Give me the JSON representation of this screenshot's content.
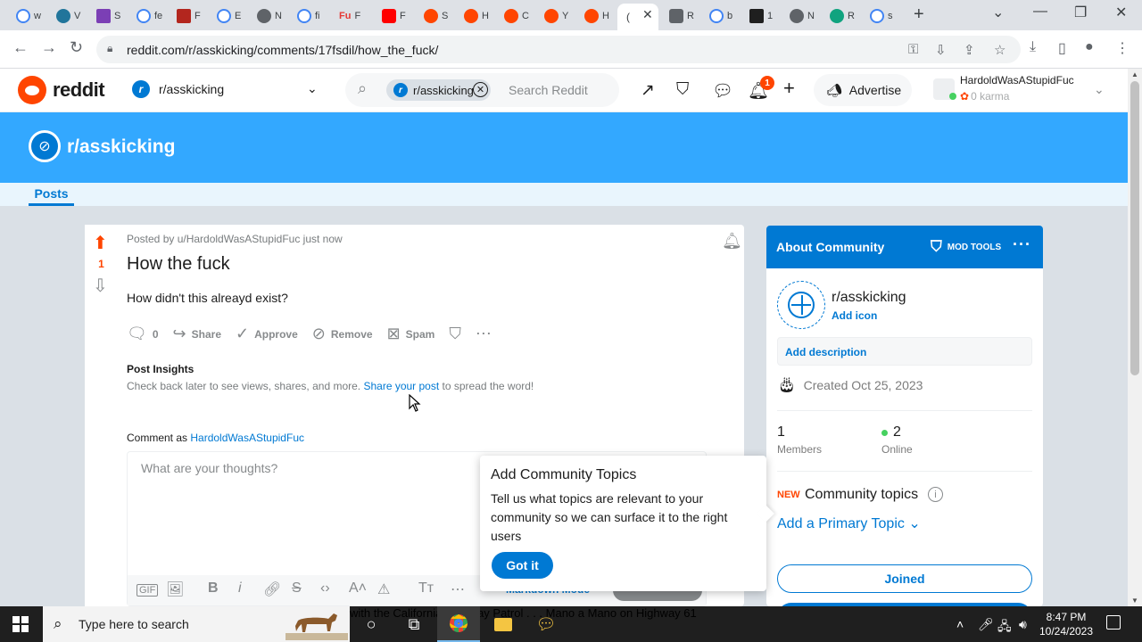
{
  "browser": {
    "tab_count": 22,
    "url": "reddit.com/r/asskicking/comments/17fsdil/how_the_fuck/"
  },
  "reddit_header": {
    "wordmark": "reddit",
    "community": "r/asskicking",
    "search_chip": "r/asskicking",
    "search_placeholder": "Search Reddit",
    "notification_count": "1",
    "advertise": "Advertise",
    "username": "HardoldWasAStupidFuc",
    "karma": "0 karma"
  },
  "banner": {
    "name": "r/asskicking",
    "nav_posts": "Posts"
  },
  "post": {
    "score": "1",
    "posted_by": "Posted by u/HardoldWasAStupidFuc just now",
    "title": "How the fuck",
    "body": "How didn't this alreayd exist?",
    "actions": {
      "comments": "0",
      "share": "Share",
      "approve": "Approve",
      "remove": "Remove",
      "spam": "Spam"
    },
    "insights_heading": "Post Insights",
    "insights_text_pre": "Check back later to see views, shares, and more.",
    "insights_link": "Share your post",
    "insights_text_post": "to spread the word!",
    "comment_as_label": "Comment as",
    "comment_as_user": "HardoldWasAStupidFuc",
    "comment_placeholder": "What are your thoughts?",
    "markdown_mode": "Markdown Mode"
  },
  "sidebar": {
    "title": "About Community",
    "mod_tools": "MOD TOOLS",
    "community_name": "r/asskicking",
    "add_icon": "Add icon",
    "add_description": "Add description",
    "created": "Created Oct 25, 2023",
    "members_count": "1",
    "members_label": "Members",
    "online_count": "2",
    "online_label": "Online",
    "new_tag": "NEW",
    "community_topics": "Community topics",
    "add_primary_topic": "Add a Primary Topic",
    "joined": "Joined"
  },
  "popup": {
    "heading": "Add Community Topics",
    "body": "Tell us what topics are relevant to your community so we can surface it to the right users",
    "button": "Got it"
  },
  "taskbar": {
    "search_placeholder": "Type here to search",
    "ticker": "with the California Highway Patrol . . . Mano a Mano on Highway 61",
    "time": "8:47 PM",
    "date": "10/24/2023"
  },
  "colors": {
    "reddit_orange": "#ff4500",
    "reddit_blue": "#0079d3",
    "banner_blue": "#33a8ff"
  }
}
